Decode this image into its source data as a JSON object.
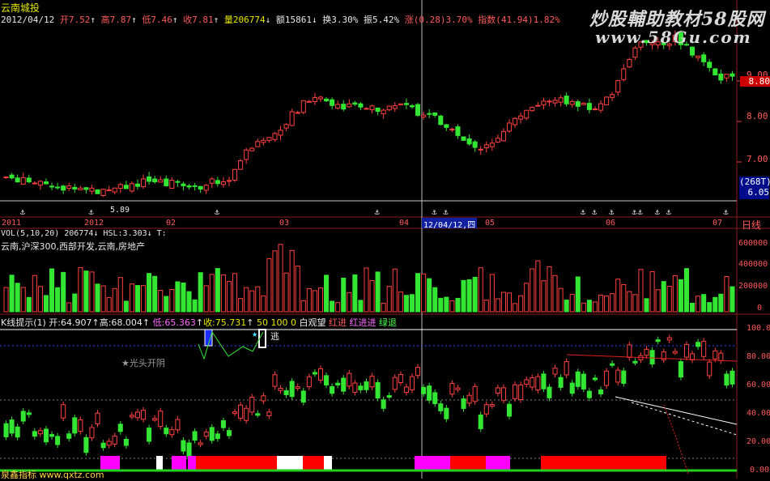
{
  "window": {
    "title": "云南城投",
    "watermark_text": "炒股輔助教材58股网",
    "watermark_url": "www.58Gu.com",
    "period_label": "日线"
  },
  "header": {
    "date": "2012/04/12",
    "open_label": "开",
    "open_value": "7.52",
    "high_label": "高",
    "high_value": "7.87",
    "low_label": "低",
    "low_value": "7.46",
    "close_label": "收",
    "close_value": "7.81",
    "volume_label": "量",
    "volume_value": "206774",
    "amount_label": "额",
    "amount_value": "15861",
    "turnover_label": "换",
    "turnover_value": "3.30%",
    "amplitude_label": "振",
    "amplitude_value": "5.42%",
    "change_label": "涨",
    "change_value": "(0.28)3.70%",
    "index_label": "指数",
    "index_value": "(41.94)1.82%"
  },
  "price_panel": {
    "price_ticks": [
      "9.00",
      "8.00",
      "7.00",
      "6.00"
    ],
    "current_price": "8.80",
    "bottom_box_line1": "(268T)",
    "bottom_box_line2": "6.05",
    "low_marker": "5.89"
  },
  "time_axis": {
    "labels": [
      "2011",
      "2012",
      "02",
      "03",
      "04",
      "12/04/12,四",
      "05",
      "06",
      "07"
    ]
  },
  "volume_panel": {
    "header": "VOL(5,10,20)  206774↓ HSL:3.303↓ T:",
    "sectors": "云南,沪深300,西部开发,云南,房地产",
    "ticks": [
      "600000",
      "400000",
      "200000",
      "0"
    ]
  },
  "indicator_panel": {
    "name": "K线提示(1)",
    "open_text": "开:64.907",
    "high_text": "高:68.004",
    "low_text": "低:65.363",
    "close_text": "收:75.731",
    "level_text": "50 100 0",
    "hint1": "白观望",
    "hint2": "红进",
    "hint3": "红进进",
    "hint4": "绿退",
    "annotation": "★光头开阴",
    "signal_text": "逃",
    "ticks": [
      "100.00",
      "80.00",
      "60.00",
      "40.00",
      "20.00",
      "0.00"
    ],
    "footer": "泉鑫指标 www.qxtz.com"
  },
  "colors": {
    "up": "#ff4040",
    "down": "#33e633",
    "grid": "#8a1c1c",
    "axis_text": "#e03a3a",
    "bar_red": "#ff0000",
    "bar_magenta": "#ff00ff",
    "bar_white": "#ffffff"
  },
  "chart_data": {
    "type": "candlestick",
    "series_length": 128,
    "highlight_date": "12/04/12"
  }
}
